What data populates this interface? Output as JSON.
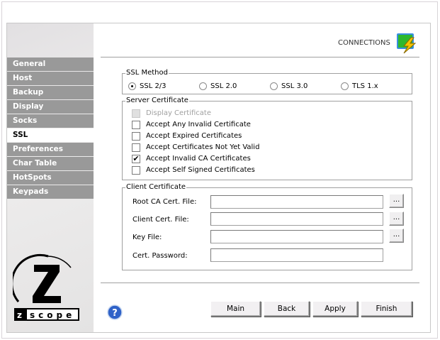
{
  "header": {
    "title": "CONNECTIONS",
    "icon": "connections-lightning-icon"
  },
  "sidebar": {
    "items": [
      {
        "label": "General"
      },
      {
        "label": "Host"
      },
      {
        "label": "Backup"
      },
      {
        "label": "Display"
      },
      {
        "label": "Socks"
      },
      {
        "label": "SSL",
        "active": true
      },
      {
        "label": "Preferences"
      },
      {
        "label": "Char Table"
      },
      {
        "label": "HotSpots"
      },
      {
        "label": "Keypads"
      }
    ],
    "logo": {
      "letter": "Z",
      "text": "z/scope"
    }
  },
  "ssl_method": {
    "legend": "SSL Method",
    "options": [
      {
        "label": "SSL 2/3",
        "selected": true
      },
      {
        "label": "SSL 2.0"
      },
      {
        "label": "SSL 3.0"
      },
      {
        "label": "TLS 1.x"
      }
    ]
  },
  "server_cert": {
    "legend": "Server Certificate",
    "options": [
      {
        "label": "Display Certificate",
        "disabled": true,
        "checked": false
      },
      {
        "label": "Accept Any Invalid Certificate",
        "checked": false
      },
      {
        "label": "Accept Expired Certificates",
        "checked": false
      },
      {
        "label": "Accept Certificates Not Yet Valid",
        "checked": false
      },
      {
        "label": "Accept Invalid CA Certificates",
        "checked": true
      },
      {
        "label": "Accept Self Signed Certificates",
        "checked": false
      }
    ]
  },
  "client_cert": {
    "legend": "Client Certificate",
    "fields": [
      {
        "label": "Root CA Cert. File:",
        "value": "",
        "browse": "..."
      },
      {
        "label": "Client Cert. File:",
        "value": "",
        "browse": "..."
      },
      {
        "label": "Key File:",
        "value": "",
        "browse": "..."
      },
      {
        "label": "Cert. Password:",
        "value": ""
      }
    ]
  },
  "footer": {
    "help_icon": "help-icon",
    "buttons": {
      "main": "Main",
      "back": "Back",
      "apply": "Apply",
      "finish": "Finish"
    }
  }
}
